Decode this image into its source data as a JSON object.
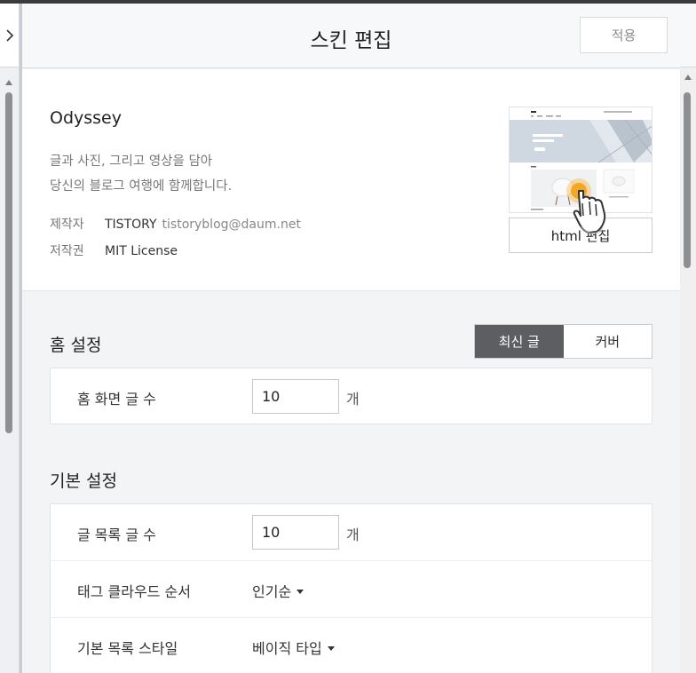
{
  "header": {
    "title": "스킨 편집",
    "apply_label": "적용"
  },
  "skin": {
    "name": "Odyssey",
    "description_line1": "글과 사진, 그리고 영상을 담아",
    "description_line2": "당신의 블로그 여행에 함께합니다.",
    "maker_key": "제작자",
    "maker_value": "TISTORY",
    "maker_email": "tistoryblog@daum.net",
    "license_key": "저작권",
    "license_value": "MIT License",
    "html_edit_label": "html 편집"
  },
  "home_settings": {
    "title": "홈 설정",
    "segment": [
      "최신 글",
      "커버"
    ],
    "selected_segment": "최신 글",
    "rows": [
      {
        "label": "홈 화면 글 수",
        "value": "10",
        "unit": "개"
      }
    ]
  },
  "basic_settings": {
    "title": "기본 설정",
    "post_count": {
      "label": "글 목록 글 수",
      "value": "10",
      "unit": "개"
    },
    "tag_cloud": {
      "label": "태그 클라우드 순서",
      "value": "인기순"
    },
    "list_style": {
      "label": "기본 목록 스타일",
      "value": "베이직 타입"
    }
  },
  "colors": {
    "accent_cursor": "#f5a623",
    "segment_active": "#5d5e61",
    "scrollbar_thumb": "#8d8f93"
  },
  "icons": {
    "expand": "chevron-right-icon",
    "cursor": "hand-pointer-icon"
  }
}
